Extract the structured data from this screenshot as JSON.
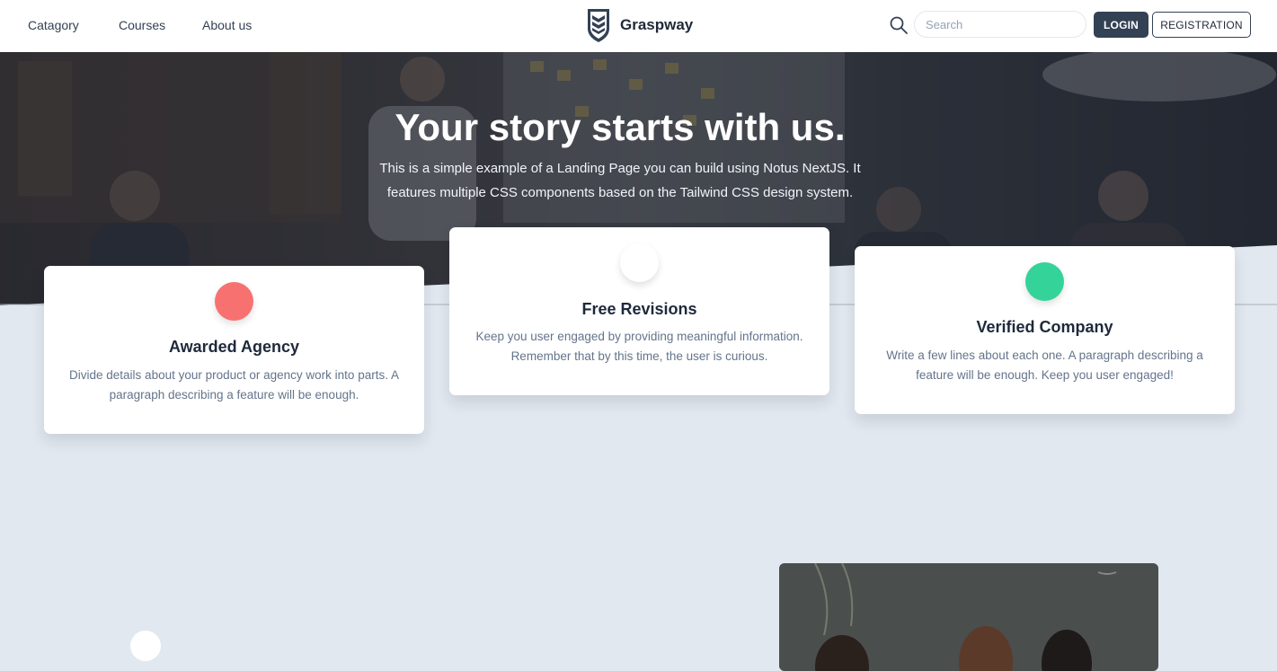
{
  "nav": {
    "links": [
      "Catagory",
      "Courses",
      "About us"
    ],
    "brand": "Graspway",
    "search_placeholder": "Search",
    "login": "LOGIN",
    "registration": "REGISTRATION"
  },
  "hero": {
    "title": "Your story starts with us.",
    "text": "This is a simple example of a Landing Page you can build using Notus NextJS. It features multiple CSS components based on the Tailwind CSS design system."
  },
  "cards": [
    {
      "title": "Awarded Agency",
      "text": "Divide details about your product or agency work into parts. A paragraph describing a feature will be enough.",
      "icon_color": "#f87171"
    },
    {
      "title": "Free Revisions",
      "text": "Keep you user engaged by providing meaningful information. Remember that by this time, the user is curious.",
      "icon_color": "#ffffff"
    },
    {
      "title": "Verified Company",
      "text": "Write a few lines about each one. A paragraph describing a feature will be enough. Keep you user engaged!",
      "icon_color": "#34d399"
    }
  ],
  "colors": {
    "page_bg": "#e2e8f0",
    "primary": "#334155"
  }
}
